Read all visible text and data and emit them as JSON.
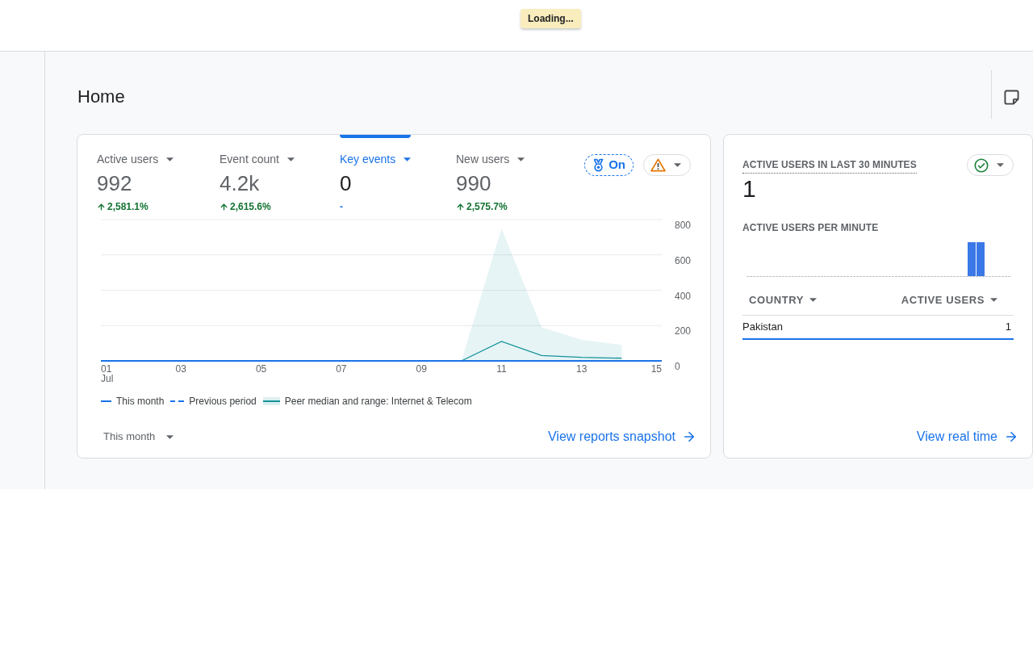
{
  "loading_indicator": {
    "text": "Loading..."
  },
  "page": {
    "title": "Home"
  },
  "overview_card": {
    "metrics": [
      {
        "label": "Active users",
        "value": "992",
        "change": "2,581.1%",
        "rising": true,
        "selected": false
      },
      {
        "label": "Event count",
        "value": "4.2k",
        "change": "2,615.6%",
        "rising": true,
        "selected": false
      },
      {
        "label": "Key events",
        "value": "0",
        "change": "-",
        "rising": false,
        "selected": true
      },
      {
        "label": "New users",
        "value": "990",
        "change": "2,575.7%",
        "rising": true,
        "selected": false
      }
    ],
    "insights_toggle": {
      "label": "On"
    },
    "status_button": {
      "kind": "warning"
    },
    "chart_data": {
      "type": "line",
      "grid": true,
      "x": [
        1,
        2,
        3,
        4,
        5,
        6,
        7,
        8,
        9,
        10,
        11,
        12,
        13,
        14,
        15
      ],
      "xlim": [
        1,
        15
      ],
      "ylim": [
        0,
        800
      ],
      "xticks": [
        {
          "value": 1,
          "label": "01"
        },
        {
          "value": 3,
          "label": "03"
        },
        {
          "value": 5,
          "label": "05"
        },
        {
          "value": 7,
          "label": "07"
        },
        {
          "value": 9,
          "label": "09"
        },
        {
          "value": 11,
          "label": "11"
        },
        {
          "value": 13,
          "label": "13"
        },
        {
          "value": 15,
          "label": "15"
        }
      ],
      "yticks": [
        0,
        200,
        400,
        600,
        800
      ],
      "series": [
        {
          "name": "This month",
          "color": "#1a73e8",
          "line_style": "solid",
          "values": [
            0,
            0,
            0,
            0,
            0,
            0,
            0,
            0,
            0,
            0,
            0,
            0,
            0,
            0,
            0
          ]
        },
        {
          "name": "Previous period",
          "color": "#1a73e8",
          "line_style": "dashed",
          "values": [
            null,
            null,
            null,
            null,
            null,
            null,
            null,
            null,
            null,
            null,
            null,
            null,
            null,
            null,
            null
          ]
        },
        {
          "name": "Peer median and range: Internet & Telecom",
          "color": "#12939a",
          "line_style": "solid",
          "values": [
            null,
            null,
            null,
            null,
            null,
            null,
            null,
            null,
            null,
            0,
            110,
            30,
            20,
            15,
            null
          ]
        },
        {
          "type": "area",
          "color": "#12939a",
          "values": [
            null,
            null,
            null,
            null,
            null,
            null,
            null,
            null,
            null,
            0,
            750,
            190,
            120,
            90,
            null
          ]
        }
      ]
    },
    "x_axis_month": "Jul",
    "date_range": {
      "label": "This month"
    },
    "link": {
      "label": "View reports snapshot"
    }
  },
  "realtime_card": {
    "title": "ACTIVE USERS IN LAST 30 MINUTES",
    "value": "1",
    "status_button": {
      "kind": "ok"
    },
    "subtitle": "ACTIVE USERS PER MINUTE",
    "table": {
      "columns": [
        "COUNTRY",
        "ACTIVE USERS"
      ],
      "rows": [
        {
          "cells": [
            "Pakistan",
            "1"
          ],
          "level": 1
        }
      ]
    },
    "link": {
      "label": "View real time"
    }
  }
}
